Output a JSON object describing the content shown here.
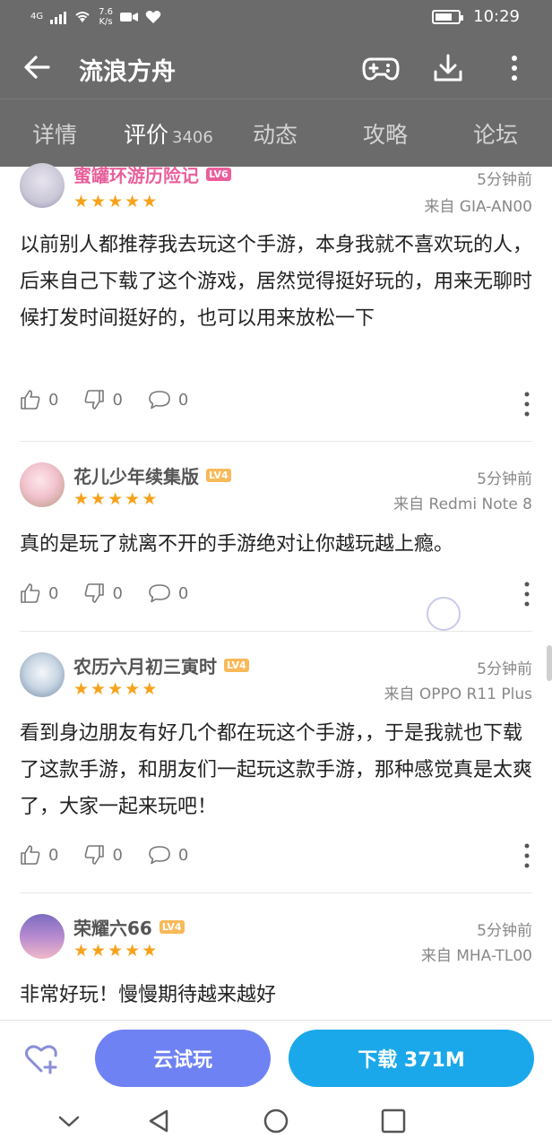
{
  "status": {
    "network_label": "4G",
    "speed_value": "7.6",
    "speed_unit": "K/s",
    "time": "10:29"
  },
  "header": {
    "title": "流浪方舟",
    "back_icon": "arrow-left-icon",
    "gamepad_icon": "gamepad-icon",
    "download_icon": "download-icon",
    "more_icon": "more-vertical-icon"
  },
  "tabs": [
    {
      "label": "详情"
    },
    {
      "label": "评价",
      "count": "3406",
      "active": true
    },
    {
      "label": "动态"
    },
    {
      "label": "攻略"
    },
    {
      "label": "论坛"
    }
  ],
  "reviews": [
    {
      "username": "蜜罐环游历险记",
      "level": "LV6",
      "level_color": "#ea5f9b",
      "time": "5分钟前",
      "device": "来自 GIA-AN00",
      "rating": 5,
      "text": "以前别人都推荐我去玩这个手游，本身我就不喜欢玩的人，后来自己下载了这个游戏，居然觉得挺好玩的，用来无聊时候打发时间挺好的，也可以用来放松一下",
      "likes": "0",
      "dislikes": "0",
      "comments": "0"
    },
    {
      "username": "花儿少年续集版",
      "level": "LV4",
      "level_color": "#f8b95a",
      "time": "5分钟前",
      "device": "来自 Redmi Note 8",
      "rating": 5,
      "text": "真的是玩了就离不开的手游绝对让你越玩越上瘾。",
      "likes": "0",
      "dislikes": "0",
      "comments": "0"
    },
    {
      "username": "农历六月初三寅时",
      "level": "LV4",
      "level_color": "#f8b95a",
      "time": "5分钟前",
      "device": "来自 OPPO R11 Plus",
      "rating": 5,
      "text": "看到身边朋友有好几个都在玩这个手游，，于是我就也下载了这款手游，和朋友们一起玩这款手游，那种感觉真是太爽了，大家一起来玩吧！",
      "likes": "0",
      "dislikes": "0",
      "comments": "0"
    },
    {
      "username": "荣耀六66",
      "level": "LV4",
      "level_color": "#f8b95a",
      "time": "5分钟前",
      "device": "来自 MHA-TL00",
      "rating": 5,
      "text": "非常好玩！慢慢期待越来越好"
    }
  ],
  "bottom": {
    "trial_label": "云试玩",
    "download_label": "下载 371M",
    "favorite_icon": "heart-plus-icon"
  },
  "colors": {
    "header_bg": "#6b6b6b",
    "trial_btn": "#6f82f3",
    "download_btn": "#1ba8ea",
    "star": "#f7a21b"
  }
}
